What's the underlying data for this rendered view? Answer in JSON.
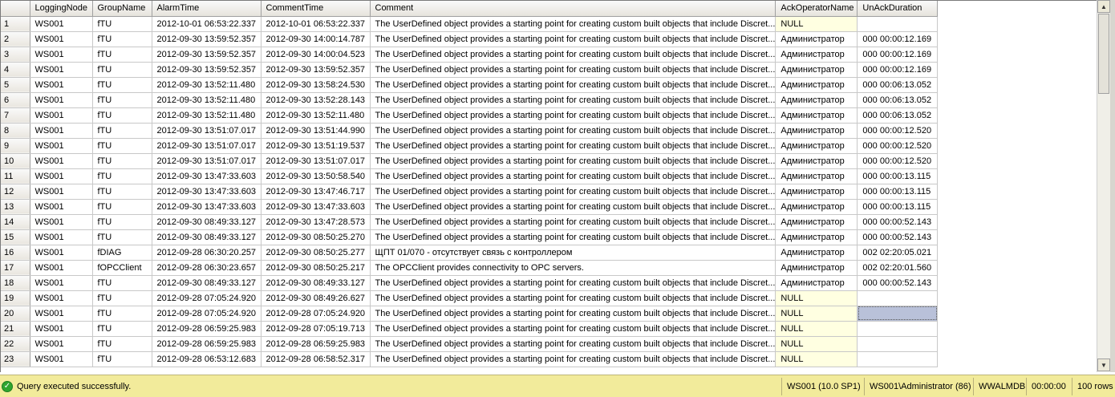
{
  "grid": {
    "columns": [
      "LoggingNode",
      "GroupName",
      "AlarmTime",
      "CommentTime",
      "Comment",
      "AckOperatorName",
      "UnAckDuration"
    ],
    "rows": [
      [
        "1",
        "WS001",
        "fTU",
        "2012-10-01 06:53:22.337",
        "2012-10-01 06:53:22.337",
        "The UserDefined object provides a starting point for creating custom built objects that include Discret...",
        "NULL",
        ""
      ],
      [
        "2",
        "WS001",
        "fTU",
        "2012-09-30 13:59:52.357",
        "2012-09-30 14:00:14.787",
        "The UserDefined object provides a starting point for creating custom built objects that include Discret...",
        "Администратор",
        "000 00:00:12.169"
      ],
      [
        "3",
        "WS001",
        "fTU",
        "2012-09-30 13:59:52.357",
        "2012-09-30 14:00:04.523",
        "The UserDefined object provides a starting point for creating custom built objects that include Discret...",
        "Администратор",
        "000 00:00:12.169"
      ],
      [
        "4",
        "WS001",
        "fTU",
        "2012-09-30 13:59:52.357",
        "2012-09-30 13:59:52.357",
        "The UserDefined object provides a starting point for creating custom built objects that include Discret...",
        "Администратор",
        "000 00:00:12.169"
      ],
      [
        "5",
        "WS001",
        "fTU",
        "2012-09-30 13:52:11.480",
        "2012-09-30 13:58:24.530",
        "The UserDefined object provides a starting point for creating custom built objects that include Discret...",
        "Администратор",
        "000 00:06:13.052"
      ],
      [
        "6",
        "WS001",
        "fTU",
        "2012-09-30 13:52:11.480",
        "2012-09-30 13:52:28.143",
        "The UserDefined object provides a starting point for creating custom built objects that include Discret...",
        "Администратор",
        "000 00:06:13.052"
      ],
      [
        "7",
        "WS001",
        "fTU",
        "2012-09-30 13:52:11.480",
        "2012-09-30 13:52:11.480",
        "The UserDefined object provides a starting point for creating custom built objects that include Discret...",
        "Администратор",
        "000 00:06:13.052"
      ],
      [
        "8",
        "WS001",
        "fTU",
        "2012-09-30 13:51:07.017",
        "2012-09-30 13:51:44.990",
        "The UserDefined object provides a starting point for creating custom built objects that include Discret...",
        "Администратор",
        "000 00:00:12.520"
      ],
      [
        "9",
        "WS001",
        "fTU",
        "2012-09-30 13:51:07.017",
        "2012-09-30 13:51:19.537",
        "The UserDefined object provides a starting point for creating custom built objects that include Discret...",
        "Администратор",
        "000 00:00:12.520"
      ],
      [
        "10",
        "WS001",
        "fTU",
        "2012-09-30 13:51:07.017",
        "2012-09-30 13:51:07.017",
        "The UserDefined object provides a starting point for creating custom built objects that include Discret...",
        "Администратор",
        "000 00:00:12.520"
      ],
      [
        "11",
        "WS001",
        "fTU",
        "2012-09-30 13:47:33.603",
        "2012-09-30 13:50:58.540",
        "The UserDefined object provides a starting point for creating custom built objects that include Discret...",
        "Администратор",
        "000 00:00:13.115"
      ],
      [
        "12",
        "WS001",
        "fTU",
        "2012-09-30 13:47:33.603",
        "2012-09-30 13:47:46.717",
        "The UserDefined object provides a starting point for creating custom built objects that include Discret...",
        "Администратор",
        "000 00:00:13.115"
      ],
      [
        "13",
        "WS001",
        "fTU",
        "2012-09-30 13:47:33.603",
        "2012-09-30 13:47:33.603",
        "The UserDefined object provides a starting point for creating custom built objects that include Discret...",
        "Администратор",
        "000 00:00:13.115"
      ],
      [
        "14",
        "WS001",
        "fTU",
        "2012-09-30 08:49:33.127",
        "2012-09-30 13:47:28.573",
        "The UserDefined object provides a starting point for creating custom built objects that include Discret...",
        "Администратор",
        "000 00:00:52.143"
      ],
      [
        "15",
        "WS001",
        "fTU",
        "2012-09-30 08:49:33.127",
        "2012-09-30 08:50:25.270",
        "The UserDefined object provides a starting point for creating custom built objects that include Discret...",
        "Администратор",
        "000 00:00:52.143"
      ],
      [
        "16",
        "WS001",
        "fDIAG",
        "2012-09-28 06:30:20.257",
        "2012-09-30 08:50:25.277",
        "ЩПТ 01/070  - отсутствует связь с контроллером",
        "Администратор",
        "002 02:20:05.021"
      ],
      [
        "17",
        "WS001",
        "fOPCClient",
        "2012-09-28 06:30:23.657",
        "2012-09-30 08:50:25.217",
        "The OPCClient provides connectivity to OPC servers.",
        "Администратор",
        "002 02:20:01.560"
      ],
      [
        "18",
        "WS001",
        "fTU",
        "2012-09-30 08:49:33.127",
        "2012-09-30 08:49:33.127",
        "The UserDefined object provides a starting point for creating custom built objects that include Discret...",
        "Администратор",
        "000 00:00:52.143"
      ],
      [
        "19",
        "WS001",
        "fTU",
        "2012-09-28 07:05:24.920",
        "2012-09-30 08:49:26.627",
        "The UserDefined object provides a starting point for creating custom built objects that include Discret...",
        "NULL",
        ""
      ],
      [
        "20",
        "WS001",
        "fTU",
        "2012-09-28 07:05:24.920",
        "2012-09-28 07:05:24.920",
        "The UserDefined object provides a starting point for creating custom built objects that include Discret...",
        "NULL",
        ""
      ],
      [
        "21",
        "WS001",
        "fTU",
        "2012-09-28 06:59:25.983",
        "2012-09-28 07:05:19.713",
        "The UserDefined object provides a starting point for creating custom built objects that include Discret...",
        "NULL",
        ""
      ],
      [
        "22",
        "WS001",
        "fTU",
        "2012-09-28 06:59:25.983",
        "2012-09-28 06:59:25.983",
        "The UserDefined object provides a starting point for creating custom built objects that include Discret...",
        "NULL",
        ""
      ],
      [
        "23",
        "WS001",
        "fTU",
        "2012-09-28 06:53:12.683",
        "2012-09-28 06:58:52.317",
        "The UserDefined object provides a starting point for creating custom built objects that include Discret...",
        "NULL",
        ""
      ]
    ],
    "selected_row": 20
  },
  "status": {
    "message": "Query executed successfully.",
    "icon": "check-circle-icon",
    "server": "WS001 (10.0 SP1)",
    "user": "WS001\\Administrator (86)",
    "database": "WWALMDB",
    "elapsed": "00:00:00",
    "rows": "100 rows"
  },
  "colors": {
    "status_bar": "#f2eb9b",
    "null_cell": "#ffffe1",
    "selected_cell": "#b9c1d9"
  }
}
